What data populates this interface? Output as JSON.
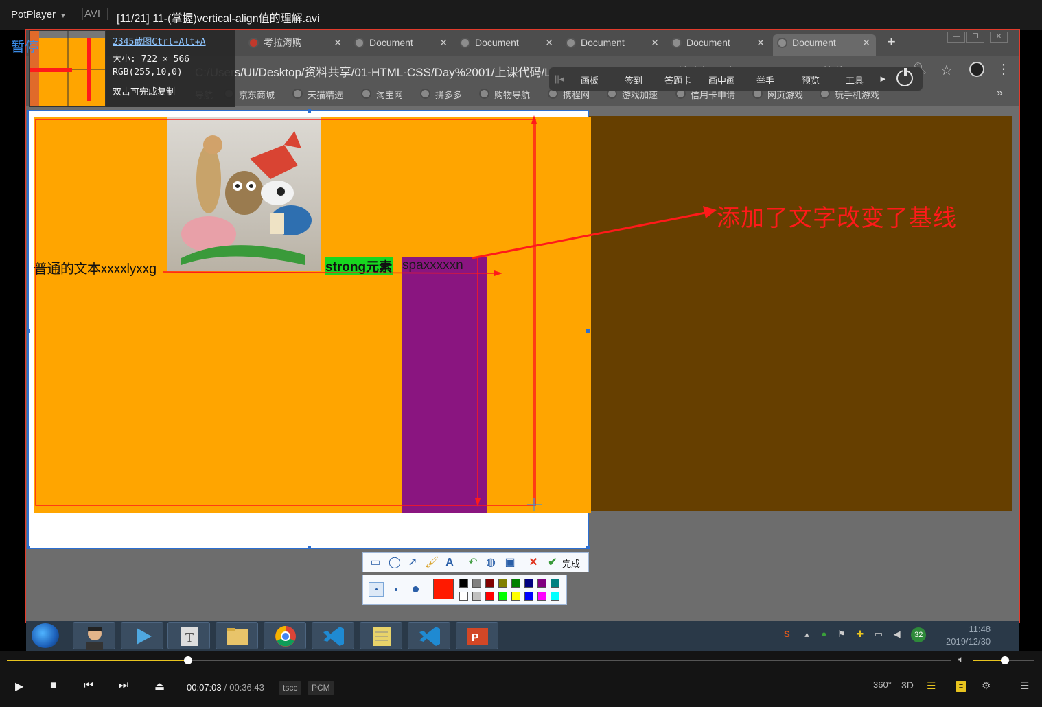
{
  "player": {
    "app_name": "PotPlayer",
    "format": "AVI",
    "file_title": "[11/21] 11-(掌握)vertical-align值的理解.avi",
    "pause_label": "暂停",
    "time_current": "00:07:03",
    "time_separator": "/",
    "time_total": "00:36:43",
    "codec_video": "tscc",
    "codec_audio": "PCM",
    "seek_progress": 0.192,
    "volume_level": 0.52,
    "right_controls": [
      "360°",
      "3D"
    ]
  },
  "browser": {
    "tabs": [
      {
        "label": "考拉海购"
      },
      {
        "label": "Document"
      },
      {
        "label": "Document"
      },
      {
        "label": "Document"
      },
      {
        "label": "Document"
      },
      {
        "label": "Document",
        "active": true
      }
    ],
    "url": "C:/Users/UI/Desktop/资料共享/01-HTML-CSS/Day%2001/上课代码/LearnHTML-CSS/14-CSS补充知识点/08-vertical-align的使用...",
    "bookmarks": [
      "导航",
      "京东商城",
      "天猫精选",
      "淘宝网",
      "拼多多",
      "购物导航",
      "携程网",
      "游戏加速",
      "信用卡申请",
      "网页游戏",
      "玩手机游戏"
    ]
  },
  "float_toolbar": {
    "items": [
      "画板",
      "签到",
      "答题卡",
      "画中画",
      "举手",
      "预览",
      "工具"
    ]
  },
  "page_content": {
    "normal_text": "普通的文本xxxxlyxxg",
    "strong_text": "strong元素",
    "span_text": "spaxxxxxn",
    "annotation": "添加了文字改变了基线"
  },
  "capture_info": {
    "title": "2345截图Ctrl+Alt+A",
    "size": "大小: 722 × 566",
    "rgb": "RGB(255,10,0)",
    "hint": "双击可完成复制"
  },
  "capture_toolbar": {
    "done_label": "完成"
  },
  "palette": {
    "selected": "#ff1a00",
    "row1": [
      "#000000",
      "#808080",
      "#800000",
      "#808000",
      "#008000",
      "#000080",
      "#800080",
      "#008080"
    ],
    "row2": [
      "#ffffff",
      "#c0c0c0",
      "#ff0000",
      "#00ff00",
      "#ffff00",
      "#0000ff",
      "#ff00ff",
      "#00ffff"
    ]
  },
  "taskbar": {
    "clock_time": "11:48",
    "clock_date": "2019/12/30",
    "badge_count": "32"
  },
  "colors": {
    "accent": "#e8c41f",
    "orange": "#ffa500",
    "purple": "#8a1580",
    "strong_bg": "#17d61f",
    "annotation": "#ff1a1a"
  }
}
